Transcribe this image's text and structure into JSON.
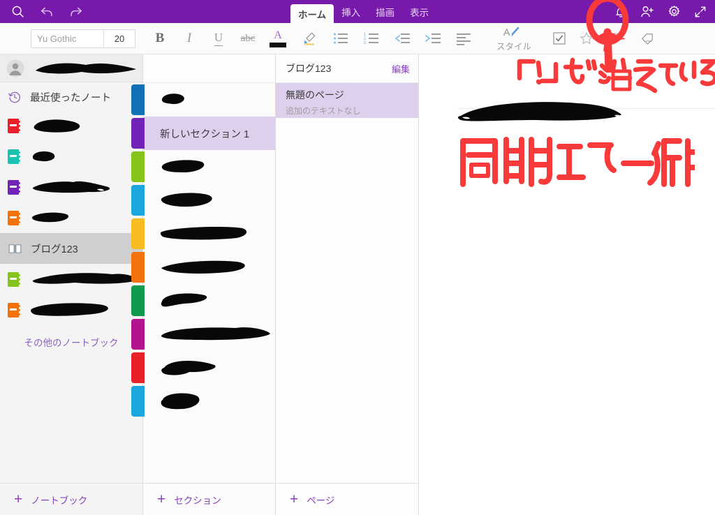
{
  "app": {
    "accent": "#7719aa",
    "ink_red": "#f93a3a",
    "redaction_color": "#080808"
  },
  "ribbon": {
    "left_icons": [
      {
        "name": "search-icon",
        "label": "検索"
      },
      {
        "name": "undo-icon",
        "label": "元に戻す"
      },
      {
        "name": "redo-icon",
        "label": "やり直し"
      }
    ],
    "tabs": [
      {
        "label": "ホーム",
        "active": true
      },
      {
        "label": "挿入",
        "active": false
      },
      {
        "label": "描画",
        "active": false
      },
      {
        "label": "表示",
        "active": false
      }
    ],
    "right_icons": [
      {
        "name": "bell-icon",
        "label": "通知"
      },
      {
        "name": "add-person-icon",
        "label": "共有"
      },
      {
        "name": "gear-icon",
        "label": "設定"
      },
      {
        "name": "expand-icon",
        "label": "全画面表示"
      }
    ]
  },
  "formatbar": {
    "font_name": "Yu Gothic",
    "font_name_placeholder": "Yu Gothic",
    "font_size": "20",
    "buttons": [
      {
        "name": "bold-button",
        "label": "B"
      },
      {
        "name": "italic-button",
        "label": "I"
      },
      {
        "name": "underline-button",
        "label": "U"
      },
      {
        "name": "strikethrough-button",
        "label": "abc"
      },
      {
        "name": "font-color-button",
        "label": "A",
        "swatch": "#101010"
      },
      {
        "name": "highlighter-button",
        "label": ""
      },
      {
        "name": "bulleted-list-button",
        "label": ""
      },
      {
        "name": "numbered-list-button",
        "label": ""
      },
      {
        "name": "decrease-indent-button",
        "label": ""
      },
      {
        "name": "increase-indent-button",
        "label": ""
      },
      {
        "name": "alignment-button",
        "label": ""
      },
      {
        "name": "styles-button",
        "label": "スタイル"
      },
      {
        "name": "todo-checkbox-button",
        "label": ""
      },
      {
        "name": "star-tag-button",
        "label": ""
      },
      {
        "name": "help-button",
        "label": "?"
      },
      {
        "name": "tag-more-button",
        "label": ""
      }
    ]
  },
  "notebook_panel": {
    "account": {
      "name": "",
      "redacted": true
    },
    "recent_label": "最近使ったノート",
    "items": [
      {
        "label": "",
        "color": "#e8202a",
        "redacted": true,
        "redact_w": 74,
        "redact_h": 22,
        "selected": false
      },
      {
        "label": "",
        "color": "#18c3b0",
        "redacted": true,
        "redact_w": 35,
        "redact_h": 18,
        "selected": false
      },
      {
        "label": "",
        "color": "#7123b8",
        "redacted": true,
        "redact_w": 116,
        "redact_h": 20,
        "selected": false
      },
      {
        "label": "",
        "color": "#f4720b",
        "redacted": true,
        "redact_w": 56,
        "redact_h": 17,
        "selected": false
      },
      {
        "label": "ブログ123",
        "color": "",
        "redacted": false,
        "selected": true,
        "icon": "open-book-icon"
      },
      {
        "label": "",
        "color": "#84c41b",
        "redacted": true,
        "redact_w": 154,
        "redact_h": 21,
        "selected": false
      },
      {
        "label": "",
        "color": "#f4720b",
        "redacted": true,
        "redact_w": 124,
        "redact_h": 22,
        "selected": false
      }
    ],
    "other_notebooks_label": "その他のノートブック"
  },
  "section_panel": {
    "items": [
      {
        "label": "",
        "color": "#1271b5",
        "redacted": true,
        "redact_w": 35,
        "redact_h": 20,
        "selected": false
      },
      {
        "label": "新しいセクション 1",
        "color": "#7123b8",
        "redacted": false,
        "selected": true
      },
      {
        "label": "",
        "color": "#84c41b",
        "redacted": true,
        "redact_w": 61,
        "redact_h": 22,
        "selected": false
      },
      {
        "label": "",
        "color": "#1ba6dd",
        "redacted": true,
        "redact_w": 73,
        "redact_h": 22,
        "selected": false
      },
      {
        "label": "",
        "color": "#f7bc20",
        "redacted": true,
        "redact_w": 119,
        "redact_h": 20,
        "selected": false
      },
      {
        "label": "",
        "color": "#f4720b",
        "redacted": true,
        "redact_w": 124,
        "redact_h": 20,
        "selected": false
      },
      {
        "label": "",
        "color": "#119a4e",
        "redacted": true,
        "redact_w": 66,
        "redact_h": 23,
        "selected": false
      },
      {
        "label": "",
        "color": "#b4128e",
        "redacted": true,
        "redact_w": 151,
        "redact_h": 22,
        "selected": false
      },
      {
        "label": "",
        "color": "#e8202a",
        "redacted": true,
        "redact_w": 80,
        "redact_h": 26,
        "selected": false
      },
      {
        "label": "",
        "color": "#1ba6dd",
        "redacted": true,
        "redact_w": 56,
        "redact_h": 27,
        "selected": false
      }
    ]
  },
  "page_panel": {
    "title": "ブログ123",
    "edit_label": "編集",
    "pages": [
      {
        "title": "無題のページ",
        "subtitle": "追加のテキストなし",
        "selected": true
      }
    ]
  },
  "bottom_bar": {
    "add_notebook": "ノートブック",
    "add_section": "セクション",
    "add_page": "ページ"
  },
  "annotations": {
    "circle_target": "同期状態アイコン",
    "note_top": "「!」が消えているので",
    "note_bottom": "同期エラー 解消!",
    "redacted_title": true
  }
}
